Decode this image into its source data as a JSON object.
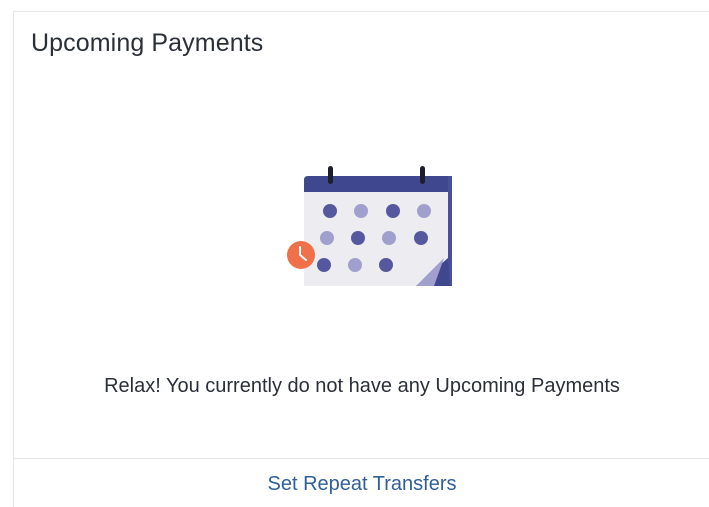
{
  "card": {
    "title": "Upcoming Payments",
    "empty_state": {
      "illustration_icon": "calendar-clock-icon",
      "message": "Relax! You currently do not have any Upcoming Payments"
    },
    "footer": {
      "link_label": "Set Repeat Transfers"
    }
  },
  "colors": {
    "calendar_header": "#3f478f",
    "dot_dark": "#55589f",
    "dot_light": "#a19fcd",
    "page_fold": "#7a78b6",
    "clock": "#f0704a",
    "link": "#2f5f99"
  }
}
